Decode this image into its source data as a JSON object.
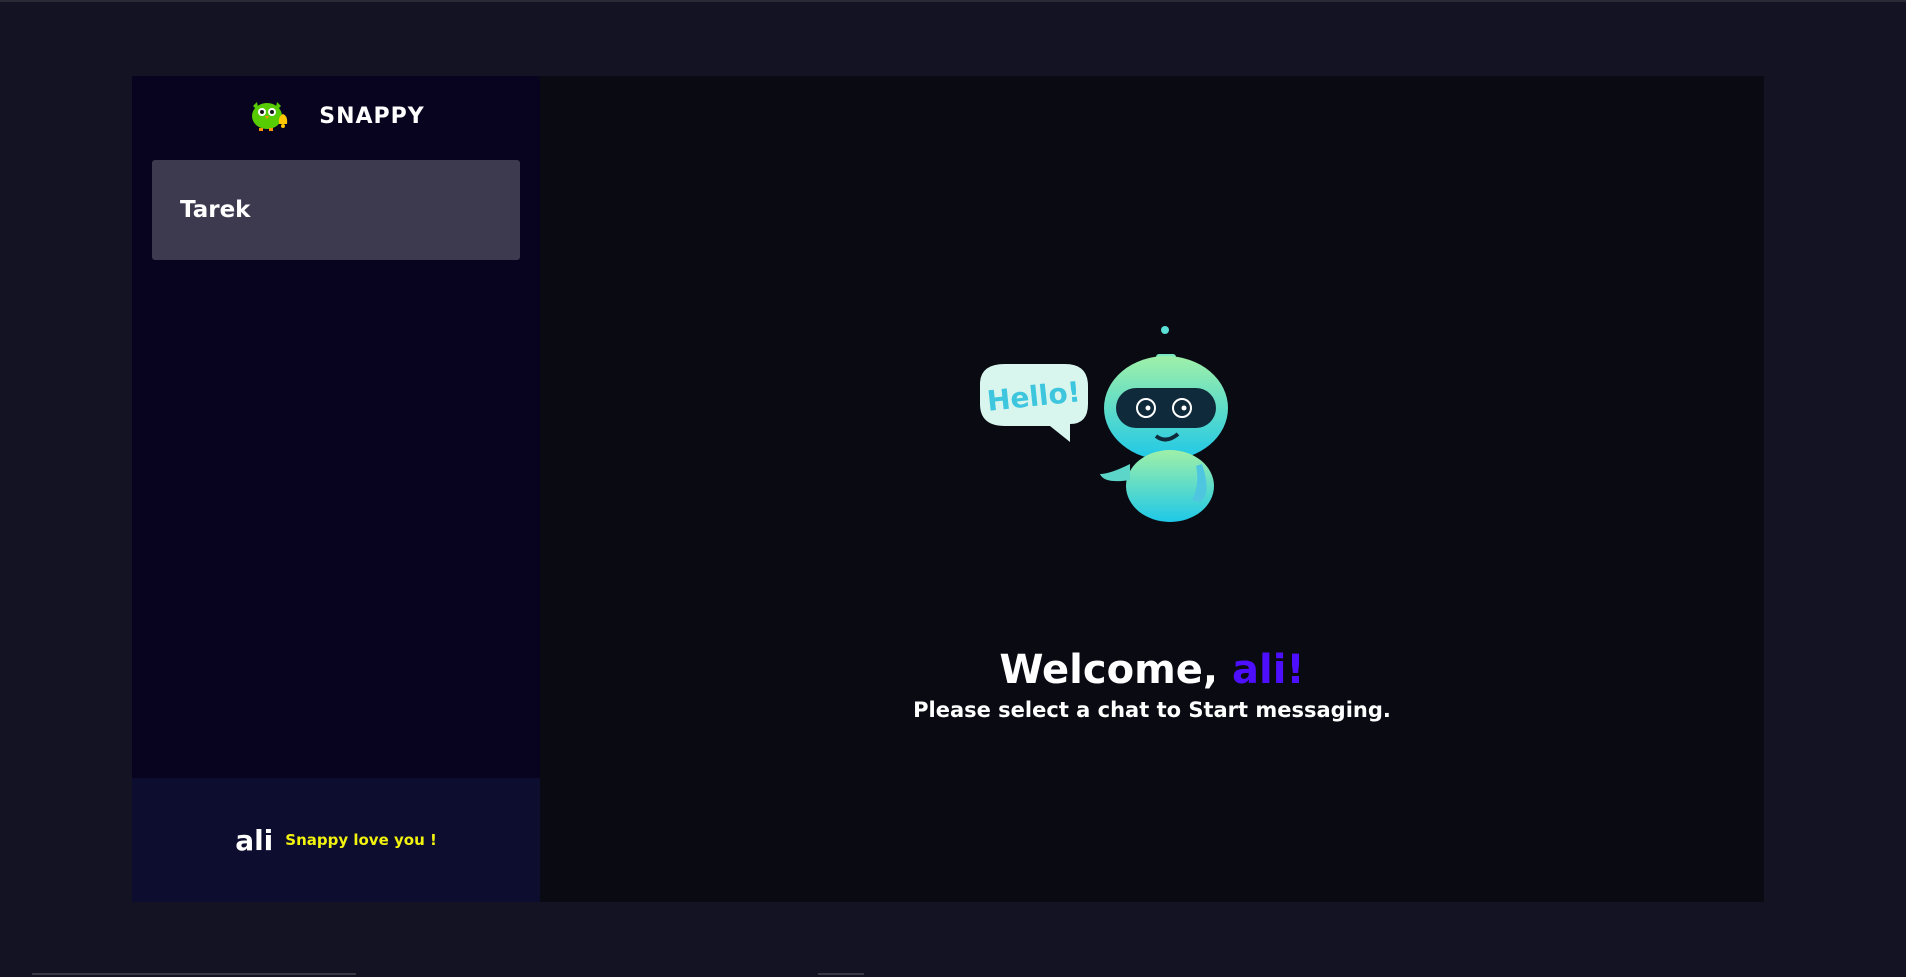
{
  "brand": {
    "name": "SNAPPY",
    "logo_icon": "owl-logo-icon"
  },
  "contacts": [
    {
      "name": "Tarek",
      "selected": true
    }
  ],
  "current_user": {
    "name": "ali",
    "tagline": "Snappy love you !"
  },
  "welcome": {
    "prefix": "Welcome, ",
    "username": "ali!",
    "subtitle": "Please select a chat to Start messaging.",
    "robot_icon": "robot-hello-icon",
    "bubble_text": "Hello!"
  },
  "colors": {
    "background": "#131324",
    "sidebar": "#080420",
    "contact_selected": "#3d3a50",
    "user_panel": "#0d0d30",
    "main": "#0a0b12",
    "accent": "#4e0eff",
    "tagline": "#f2f20f"
  }
}
